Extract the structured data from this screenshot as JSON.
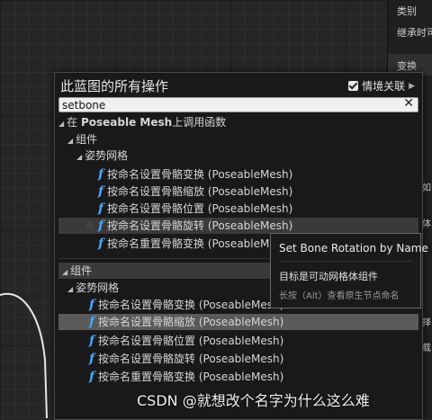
{
  "right_panel": {
    "category": "类别",
    "inherit": "继承时可",
    "transform": "变换"
  },
  "menu": {
    "title": "此蓝图的所有操作",
    "context_label": "情境关联",
    "context_checked": true,
    "search": {
      "value": "setbone",
      "placeholder": ""
    },
    "section1": {
      "header_prefix": "在 ",
      "header_bold": "Poseable Mesh",
      "header_suffix": "上调用函数",
      "group": "组件",
      "subgroup": "姿势网格",
      "items": [
        "按命名设置骨骼变换 (PoseableMesh)",
        "按命名设置骨骼缩放 (PoseableMesh)",
        "按命名设置骨骼位置 (PoseableMesh)",
        "按命名设置骨骼旋转 (PoseableMesh)",
        "按命名重置骨骼变换 (PoseableMesh)"
      ]
    },
    "section2": {
      "group": "组件",
      "subgroup": "姿势网格",
      "items": [
        "按命名设置骨骼变换 (PoseableMesh)",
        "按命名设置骨骼缩放 (PoseableMesh)",
        "按命名设置骨骼位置 (PoseableMesh)",
        "按命名设置骨骼旋转 (PoseableMesh)",
        "按命名重置骨骼变换 (PoseableMesh)"
      ]
    }
  },
  "tooltip": {
    "title": "Set Bone Rotation by Name",
    "target": "目标是可动网格体组件",
    "hint": "长按（Alt）查看原生节点命名"
  },
  "watermark": "CSDN @就想改个名字为什么这么难",
  "colors": {
    "function_icon": "#4aa8ff",
    "selected_row": "#5a5a5a"
  },
  "icons": {
    "function": "f",
    "clear": "close-icon",
    "expand": "triangle-down-icon"
  }
}
